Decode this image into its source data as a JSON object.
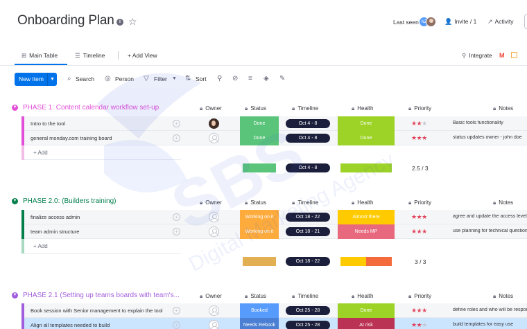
{
  "header": {
    "title": "Onboarding Plan",
    "info_glyph": "i",
    "star_glyph": "☆",
    "last_seen": "Last seen",
    "avatar_initials": "NZ",
    "invite": "Invite / 1",
    "activity": "Activity"
  },
  "tabs": {
    "main_table": "Main Table",
    "timeline": "Timeline",
    "add_view": "+  Add View",
    "integrate": "Integrate",
    "gmail_glyph": "M"
  },
  "toolbar": {
    "new_item": "New Item",
    "search": "Search",
    "person": "Person",
    "filter": "Filter",
    "sort": "Sort"
  },
  "columns": {
    "owner": "Owner",
    "status": "Status",
    "timeline": "Timeline",
    "health": "Health",
    "priority": "Priority",
    "notes": "Notes"
  },
  "groups": [
    {
      "title": "PHASE 1: Content calendar workflow set-up",
      "color": "#e44fd8",
      "rows": [
        {
          "name": "Intro to the tool",
          "owner": "photo",
          "status": "Done",
          "status_color": "#5ac57a",
          "timeline": "Oct 4 - 8",
          "health": "Done",
          "health_color": "#9cd326",
          "stars": 2,
          "notes": "Basic tools functionality"
        },
        {
          "name": "general monday.com training board",
          "owner": "empty",
          "status": "Done",
          "status_color": "#5ac57a",
          "timeline": "Oct 4 - 8",
          "health": "Done",
          "health_color": "#9cd326",
          "stars": 3,
          "notes": "status updates owner - john doe"
        }
      ],
      "add_label": "+ Add",
      "summary": {
        "timeline": "Oct 4 - 8",
        "priority": "2.5 / 3"
      }
    },
    {
      "title": "PHASE 2.0: (Builders training)",
      "color": "#037f4c",
      "rows": [
        {
          "name": "finalize access admin",
          "owner": "empty",
          "status": "Working on it",
          "status_color": "#fdab3d",
          "timeline": "Oct 18 - 22",
          "health": "Almost there",
          "health_color": "#ffcb00",
          "stars": 3,
          "notes": "agree and update the access level"
        },
        {
          "name": "team admin structure",
          "owner": "empty",
          "status": "Working on it",
          "status_color": "#fdab3d",
          "timeline": "Oct 18 - 21",
          "health": "Needs MP",
          "health_color": "#e8697d",
          "stars": 3,
          "notes": "use planning for technical questions"
        }
      ],
      "add_label": "+ Add",
      "summary": {
        "timeline": "Oct 18 - 22",
        "priority": "3 / 3"
      }
    },
    {
      "title": "PHASE 2.1 (Setting up teams boards with team's...",
      "color": "#a25ddc",
      "rows": [
        {
          "name": "Book session with Senior management to explain the tool",
          "owner": "empty",
          "status": "Booked",
          "status_color": "#579bfc",
          "timeline": "Oct 25 - 28",
          "health": "Done",
          "health_color": "#9cd326",
          "stars": 3,
          "notes": "define roles and who will be responsible"
        },
        {
          "name": "Align all templates needed to build",
          "owner": "empty",
          "status": "Needs Rebook",
          "status_color": "#4a7fd3",
          "timeline": "Oct 25 - 28",
          "health": "At risk",
          "health_color": "#bb3354",
          "stars": 2,
          "notes": "build templates for easy use"
        }
      ]
    }
  ],
  "watermark": {
    "brand": "SBS",
    "tagline": "Digital Marketing Agency"
  }
}
